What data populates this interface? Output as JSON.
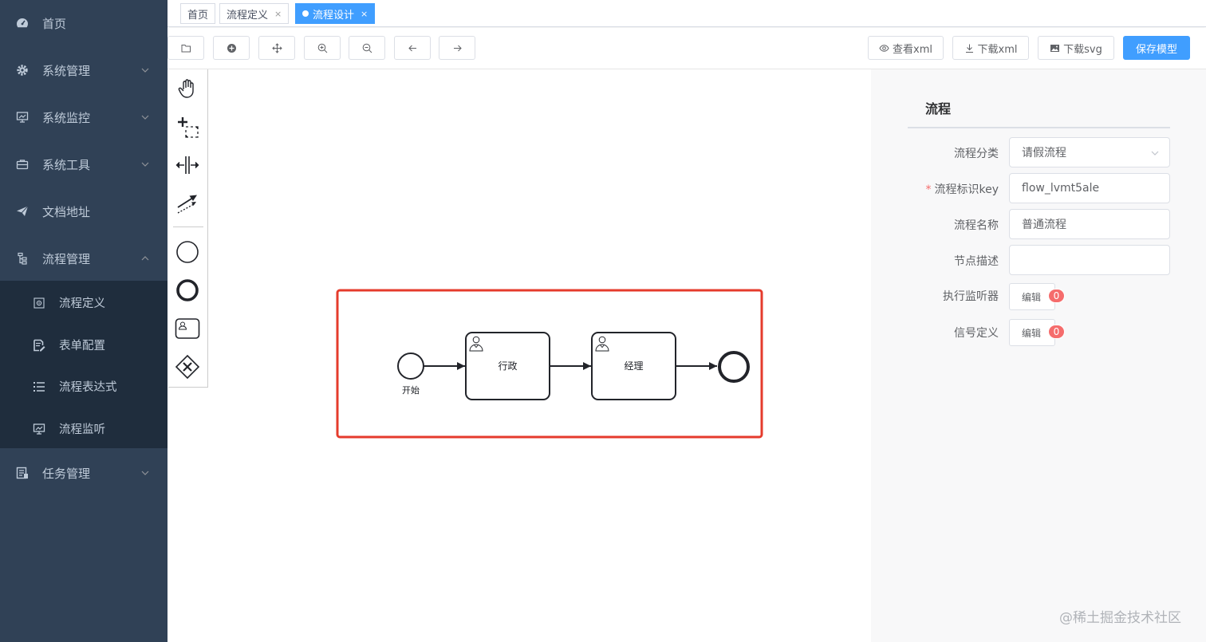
{
  "sidebar": {
    "items": [
      {
        "label": "首页",
        "icon": "dashboard-icon"
      },
      {
        "label": "系统管理",
        "icon": "gear-icon"
      },
      {
        "label": "系统监控",
        "icon": "monitor-icon"
      },
      {
        "label": "系统工具",
        "icon": "toolbox-icon"
      },
      {
        "label": "文档地址",
        "icon": "paper-plane-icon"
      },
      {
        "label": "流程管理",
        "icon": "flow-tree-icon"
      }
    ],
    "submenu": [
      {
        "label": "流程定义",
        "icon": "process-definition-icon"
      },
      {
        "label": "表单配置",
        "icon": "form-edit-icon"
      },
      {
        "label": "流程表达式",
        "icon": "list-icon"
      },
      {
        "label": "流程监听",
        "icon": "monitor-icon"
      }
    ],
    "last_item": {
      "label": "任务管理",
      "icon": "task-icon"
    }
  },
  "tags": [
    {
      "label": "首页"
    },
    {
      "label": "流程定义",
      "close": "×"
    },
    {
      "label": "流程设计",
      "close": "×",
      "active": true
    }
  ],
  "toolbar": {
    "icon_buttons": [
      "open-file-icon",
      "plus-circle-icon",
      "move-icon",
      "zoom-in-icon",
      "zoom-out-icon",
      "undo-arrow-icon",
      "redo-arrow-icon"
    ],
    "view_xml": "查看xml",
    "download_xml": "下载xml",
    "download_svg": "下载svg",
    "save_model": "保存模型"
  },
  "palette": [
    "hand-tool-icon",
    "lasso-tool-icon",
    "space-tool-icon",
    "connect-tool-icon",
    "start-event-icon",
    "end-event-icon",
    "user-task-icon",
    "exclusive-gateway-icon"
  ],
  "diagram": {
    "start_label": "开始",
    "task1": "行政",
    "task2": "经理"
  },
  "props": {
    "title": "流程",
    "category_label": "流程分类",
    "category_value": "请假流程",
    "key_required": "*",
    "key_label": "流程标识key",
    "key_value": "flow_lvmt5ale",
    "name_label": "流程名称",
    "name_value": "普通流程",
    "desc_label": "节点描述",
    "desc_value": "",
    "listener_label": "执行监听器",
    "listener_btn": "编辑",
    "listener_count": "0",
    "signal_label": "信号定义",
    "signal_btn": "编辑",
    "signal_count": "0"
  },
  "watermark": "@稀土掘金技术社区",
  "colors": {
    "sidebar_bg": "#304156",
    "submenu_bg": "#1f2d3d",
    "primary": "#409eff",
    "highlight": "#e53b2c",
    "badge": "#f56c6c"
  }
}
